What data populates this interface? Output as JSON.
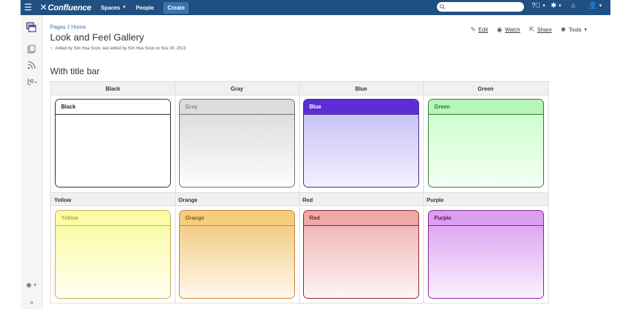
{
  "nav": {
    "logo": "Confluence",
    "spaces": "Spaces",
    "people": "People",
    "create": "Create"
  },
  "breadcrumb": {
    "pages": "Pages",
    "sep": "/",
    "home": "Home"
  },
  "page": {
    "title": "Look and Feel Gallery",
    "byline": "Added by Sim Hua Soon, last edited by Sim Hua Soon on Nov 30, 2013"
  },
  "actions": {
    "edit": "Edit",
    "watch": "Watch",
    "share": "Share",
    "tools": "Tools"
  },
  "section": {
    "title": "With title bar"
  },
  "gallery": {
    "row1_headers": [
      "Black",
      "Gray",
      "Blue",
      "Green"
    ],
    "row2_headers": [
      "Yellow",
      "Orange",
      "Red",
      "Purple"
    ],
    "panels": [
      {
        "title": "Black",
        "border": "#222222",
        "title_color": "#222222",
        "title_bg": "#ffffff",
        "body_top": "#ffffff",
        "body_bottom": "#ffffff"
      },
      {
        "title": "Gray",
        "border": "#666666",
        "title_color": "#888888",
        "title_bg": "#dcdcdc",
        "body_top": "#dedede",
        "body_bottom": "#fdfdfd"
      },
      {
        "title": "Blue",
        "border": "#3a1e8c",
        "title_color": "#ffffff",
        "title_bg": "#5c2fd6",
        "body_top": "#c9c3f5",
        "body_bottom": "#f3f1fd"
      },
      {
        "title": "Green",
        "border": "#2d6a2d",
        "title_color": "#2d7a2d",
        "title_bg": "#b8f5b8",
        "body_top": "#cfffcf",
        "body_bottom": "#f4fff4"
      },
      {
        "title": "Yellow",
        "border": "#c8a646",
        "title_color": "#b9a43a",
        "title_bg": "#fbfba8",
        "body_top": "#fafba8",
        "body_bottom": "#fefff2"
      },
      {
        "title": "Orange",
        "border": "#c27a2a",
        "title_color": "#8a5a16",
        "title_bg": "#f6cd7c",
        "body_top": "#f3cd86",
        "body_bottom": "#fff8ee"
      },
      {
        "title": "Red",
        "border": "#7a1c24",
        "title_color": "#7a1c24",
        "title_bg": "#eea9a9",
        "body_top": "#f1b8b8",
        "body_bottom": "#fff5f5"
      },
      {
        "title": "Purple",
        "border": "#7a1a8a",
        "title_color": "#5c0f6a",
        "title_bg": "#dc9ef0",
        "body_top": "#dea7f0",
        "body_bottom": "#faf2fd"
      }
    ]
  },
  "colors": {
    "topbar": "#205081",
    "create_button": "#3b73af",
    "link": "#3b73af"
  },
  "icons": {
    "menu": "hamburger-icon",
    "search": "search-icon",
    "help": "help-icon",
    "settings": "gear-icon",
    "notifications": "notifications-icon",
    "user": "user-avatar-icon"
  }
}
